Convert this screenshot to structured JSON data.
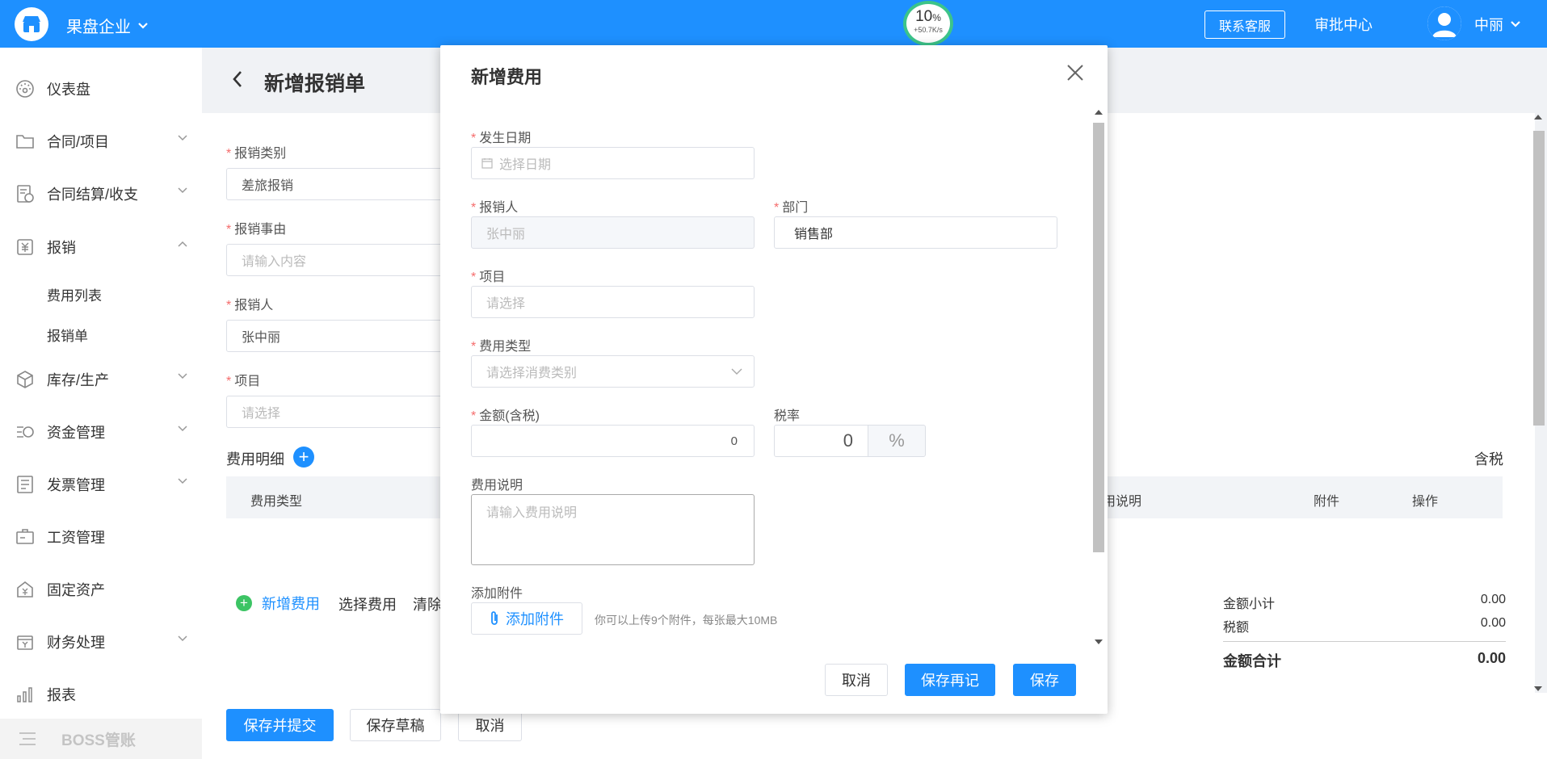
{
  "topbar": {
    "company": "果盘企业",
    "speed_percent": "10",
    "speed_percent_unit": "%",
    "speed_rate": "+50.7K/s",
    "support": "联系客服",
    "approval": "审批中心",
    "user": "中丽"
  },
  "sidebar": {
    "items": [
      {
        "label": "仪表盘",
        "icon": "dashboard-icon"
      },
      {
        "label": "合同/项目",
        "icon": "folder-icon"
      },
      {
        "label": "合同结算/收支",
        "icon": "settlement-icon"
      },
      {
        "label": "报销",
        "icon": "reimburse-icon"
      },
      {
        "label": "库存/生产",
        "icon": "box-icon"
      },
      {
        "label": "资金管理",
        "icon": "funds-icon"
      },
      {
        "label": "发票管理",
        "icon": "invoice-icon"
      },
      {
        "label": "工资管理",
        "icon": "salary-icon"
      },
      {
        "label": "固定资产",
        "icon": "asset-icon"
      },
      {
        "label": "财务处理",
        "icon": "finance-icon"
      },
      {
        "label": "报表",
        "icon": "report-icon"
      }
    ],
    "sub_items": [
      "费用列表",
      "报销单"
    ],
    "boss": "BOSS管账"
  },
  "page": {
    "title": "新增报销单",
    "type_label": "报销类别",
    "type_value": "差旅报销",
    "reason_label": "报销事由",
    "reason_placeholder": "请输入内容",
    "person_label": "报销人",
    "person_value": "张中丽",
    "project_label": "项目",
    "project_placeholder": "请选择",
    "detail_title": "费用明细",
    "tax_incl": "含税",
    "columns": [
      "费用类型",
      "用说明",
      "附件",
      "操作"
    ],
    "add_cost": "新增费用",
    "select_cost": "选择费用",
    "clear": "清除",
    "subtotal_label": "金额小计",
    "subtotal_value": "0.00",
    "tax_label": "税额",
    "tax_value": "0.00",
    "total_label": "金额合计",
    "total_value": "0.00"
  },
  "footer": {
    "submit": "保存并提交",
    "draft": "保存草稿",
    "cancel": "取消"
  },
  "modal": {
    "title": "新增费用",
    "date_label": "发生日期",
    "date_placeholder": "选择日期",
    "person_label": "报销人",
    "person_value": "张中丽",
    "dept_label": "部门",
    "dept_value": "销售部",
    "project_label": "项目",
    "project_placeholder": "请选择",
    "cost_type_label": "费用类型",
    "cost_type_placeholder": "请选择消费类别",
    "amount_label": "金额(含税)",
    "amount_value": "0",
    "tax_rate_label": "税率",
    "tax_rate_value": "0",
    "tax_rate_unit": "%",
    "desc_label": "费用说明",
    "desc_placeholder": "请输入费用说明",
    "attach_label": "添加附件",
    "attach_button": "添加附件",
    "attach_hint": "你可以上传9个附件，每张最大10MB",
    "cancel": "取消",
    "save_again": "保存再记",
    "save": "保存"
  },
  "colors": {
    "primary": "#1e90ff",
    "required": "#f56c6c",
    "success": "#3cc464"
  }
}
